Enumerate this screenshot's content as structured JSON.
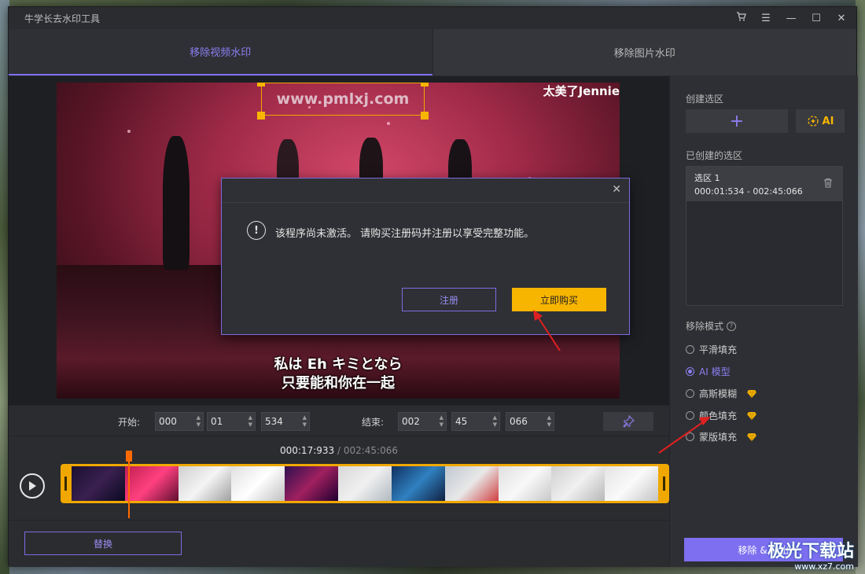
{
  "window": {
    "title": "牛学长去水印工具",
    "controls": [
      "cart-icon",
      "menu-icon",
      "minimize-icon",
      "maximize-icon",
      "close-icon"
    ]
  },
  "tabs": [
    {
      "label": "移除视频水印",
      "active": true
    },
    {
      "label": "移除图片水印",
      "active": false
    }
  ],
  "video": {
    "watermark_text": "www.pmlxj.com",
    "top_caption": "太美了Jennie",
    "subtitle_line1": "私は Eh キミとなら",
    "subtitle_line2": "只要能和你在一起"
  },
  "dialog": {
    "message": "该程序尚未激活。 请购买注册码并注册以享受完整功能。",
    "register_label": "注册",
    "buy_label": "立即购买",
    "icon": "exclamation-icon"
  },
  "time_range": {
    "start_label": "开始:",
    "start": [
      "000",
      "01",
      "534"
    ],
    "end_label": "结束:",
    "end": [
      "002",
      "45",
      "066"
    ]
  },
  "timeline": {
    "current": "000:17:933",
    "separator": " / ",
    "total": "002:45:066",
    "playhead_fraction": 0.108
  },
  "bottom": {
    "replace_label": "替换"
  },
  "sidebar": {
    "create_label": "创建选区",
    "ai_label": "AI",
    "created_label": "已创建的选区",
    "regions": [
      {
        "name": "选区 1",
        "range": "000:01:534 - 002:45:066"
      }
    ],
    "mode_label": "移除模式",
    "modes": [
      {
        "label": "平滑填充",
        "selected": false,
        "premium": false
      },
      {
        "label": "AI 模型",
        "selected": true,
        "premium": false
      },
      {
        "label": "高斯模糊",
        "selected": false,
        "premium": true
      },
      {
        "label": "颜色填充",
        "selected": false,
        "premium": true
      },
      {
        "label": "蒙版填充",
        "selected": false,
        "premium": true
      }
    ],
    "remove_label": "移除 & 导出"
  },
  "site_watermark": {
    "name": "极光下载站",
    "url": "www.xz7.com"
  },
  "colors": {
    "accent": "#7e6ff0",
    "buy": "#f7b500",
    "playhead": "#ff6a00"
  }
}
